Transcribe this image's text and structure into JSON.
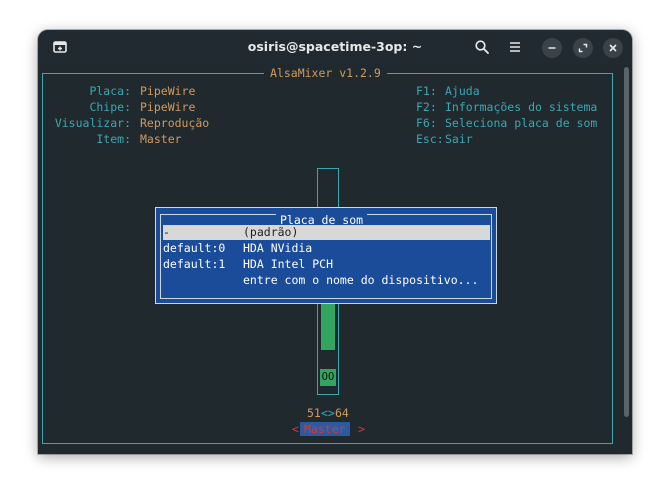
{
  "window": {
    "title": "osiris@spacetime-3op: ~"
  },
  "alsamixer": {
    "title": "AlsaMixer v1.2.9",
    "info": [
      {
        "label": "Placa:",
        "value": "PipeWire"
      },
      {
        "label": "Chipe:",
        "value": "PipeWire"
      },
      {
        "label": "Visualizar:",
        "value": "Reprodução"
      },
      {
        "label": "Item:",
        "value": "Master"
      }
    ],
    "help": [
      {
        "key": "F1:",
        "text": "Ajuda"
      },
      {
        "key": "F2:",
        "text": "Informações do sistema"
      },
      {
        "key": "F6:",
        "text": "Seleciona placa de som"
      },
      {
        "key": "Esc:",
        "text": "Sair"
      }
    ],
    "fader": {
      "level_fraction": 0.22,
      "mute_label": "OO",
      "db_left": "51",
      "db_sep": "<>",
      "db_right": "64",
      "control_left": "<",
      "control_name": "Master",
      "control_right": ">"
    }
  },
  "dialog": {
    "title": "Placa de som",
    "rows": [
      {
        "device": "-",
        "name": "(padrão)",
        "selected": true
      },
      {
        "device": "default:0",
        "name": "HDA NVidia",
        "selected": false
      },
      {
        "device": "default:1",
        "name": "HDA Intel PCH",
        "selected": false
      },
      {
        "device": "",
        "name": "entre com o nome do dispositivo...",
        "selected": false
      }
    ]
  },
  "colors": {
    "terminal_bg": "#1f292e",
    "frame": "#3aa8b2",
    "value": "#d39a5c",
    "dialog_bg": "#1b4c99",
    "fader": "#33a55f",
    "control": "#d13b3b"
  },
  "icons": {
    "new_tab": "new-tab-icon",
    "search": "search-icon",
    "menu": "hamburger-menu-icon",
    "minimize": "minimize-icon",
    "maximize": "maximize-icon",
    "close": "close-icon"
  }
}
